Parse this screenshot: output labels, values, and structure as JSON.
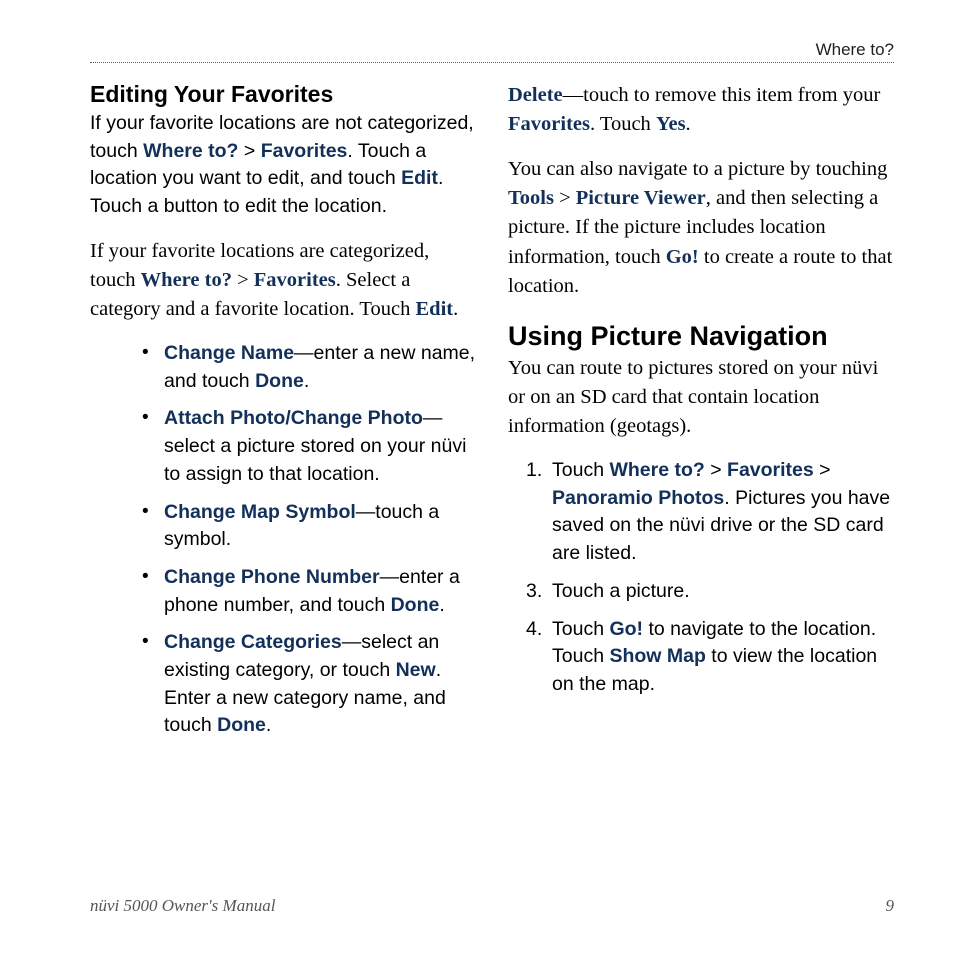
{
  "header": {
    "section": "Where to?"
  },
  "left": {
    "h_sub": "Editing Your Favorites",
    "p1_a": "If your favorite locations are not categorized, touch ",
    "p1_where": "Where to?",
    "p1_b": " > ",
    "p1_fav": "Favorites",
    "p1_c": ". Touch a location you want to edit, and touch ",
    "p1_edit": "Edit",
    "p1_d": ". Touch a button to edit the location.",
    "p2_a": "If your favorite locations are categorized, touch ",
    "p2_where": "Where to?",
    "p2_b": " > ",
    "p2_fav": "Favorites",
    "p2_c": ". Select a category and a favorite location. Touch ",
    "p2_edit": "Edit",
    "p2_d": ".",
    "bullets": {
      "b1_label": "Change Name",
      "b1_a": "—enter a new name, and touch ",
      "b1_done": "Done",
      "b1_b": ".",
      "b2_label": "Attach Photo/Change Photo",
      "b2_a": "—select a picture stored on your nüvi to assign to that location.",
      "b3_label": "Change Map Symbol",
      "b3_a": "—touch a symbol.",
      "b4_label": "Change Phone Number",
      "b4_a": "—enter a phone number, and touch ",
      "b4_done": "Done",
      "b4_b": ".",
      "b5_label": "Change Categories",
      "b5_a": "—select an existing category, or touch ",
      "b5_new": "New",
      "b5_b": ". Enter a new category name, and touch ",
      "b5_done": "Done",
      "b5_c": "."
    }
  },
  "right": {
    "p1_del": "Delete",
    "p1_a": "—touch to remove this item from your ",
    "p1_fav": "Favorites",
    "p1_b": ". Touch ",
    "p1_yes": "Yes",
    "p1_c": ".",
    "p2_a": "You can also navigate to a picture by touching ",
    "p2_tools": "Tools",
    "p2_b": " > ",
    "p2_pv": "Picture Viewer",
    "p2_c": ", and then selecting a picture. If the picture includes location information, touch ",
    "p2_go": "Go!",
    "p2_d": " to create a route to that location.",
    "h_main": "Using Picture Navigation",
    "p3": "You can route to pictures stored on your nüvi or on an SD card that contain location information (geotags).",
    "steps": {
      "s1_num": "1.",
      "s1_a": "Touch ",
      "s1_where": "Where to?",
      "s1_b": " > ",
      "s1_fav": "Favorites",
      "s1_c": " > ",
      "s1_pan": "Panoramio Photos",
      "s1_d": ". Pictures you have saved on the nüvi drive or the SD card are listed.",
      "s3_num": "3.",
      "s3_a": "Touch a picture.",
      "s4_num": "4.",
      "s4_a": "Touch ",
      "s4_go": "Go!",
      "s4_b": " to navigate to the location. Touch ",
      "s4_map": "Show Map",
      "s4_c": " to view the location on the map."
    }
  },
  "footer": {
    "left": "nüvi 5000 Owner's Manual",
    "right": "9"
  }
}
